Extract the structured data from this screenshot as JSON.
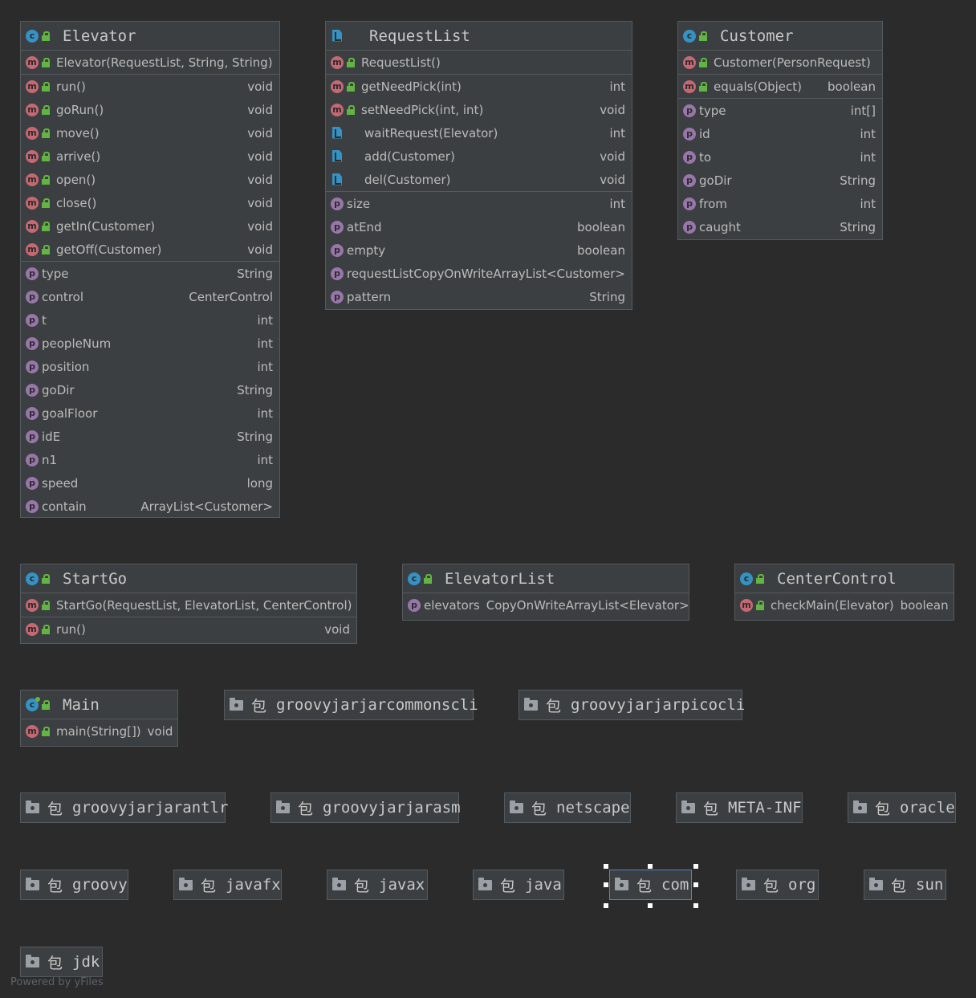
{
  "classes": {
    "elevator": {
      "title": "Elevator",
      "constructor": "Elevator(RequestList, String, String)",
      "methods": [
        {
          "name": "run()",
          "type": "void"
        },
        {
          "name": "goRun()",
          "type": "void"
        },
        {
          "name": "move()",
          "type": "void"
        },
        {
          "name": "arrive()",
          "type": "void"
        },
        {
          "name": "open()",
          "type": "void"
        },
        {
          "name": "close()",
          "type": "void"
        },
        {
          "name": "getIn(Customer)",
          "type": "void"
        },
        {
          "name": "getOff(Customer)",
          "type": "void"
        }
      ],
      "fields": [
        {
          "name": "type",
          "type": "String"
        },
        {
          "name": "control",
          "type": "CenterControl"
        },
        {
          "name": "t",
          "type": "int"
        },
        {
          "name": "peopleNum",
          "type": "int"
        },
        {
          "name": "position",
          "type": "int"
        },
        {
          "name": "goDir",
          "type": "String"
        },
        {
          "name": "goalFloor",
          "type": "int"
        },
        {
          "name": "idE",
          "type": "String"
        },
        {
          "name": "n1",
          "type": "int"
        },
        {
          "name": "speed",
          "type": "long"
        },
        {
          "name": "contain",
          "type": "ArrayList<Customer>"
        }
      ]
    },
    "requestlist": {
      "title": "RequestList",
      "constructor": "RequestList()",
      "methods": [
        {
          "name": "getNeedPick(int)",
          "type": "int"
        },
        {
          "name": "setNeedPick(int, int)",
          "type": "void"
        },
        {
          "name": "waitRequest(Elevator)",
          "type": "int"
        },
        {
          "name": "add(Customer)",
          "type": "void"
        },
        {
          "name": "del(Customer)",
          "type": "void"
        }
      ],
      "fields": [
        {
          "name": "size",
          "type": "int"
        },
        {
          "name": "atEnd",
          "type": "boolean"
        },
        {
          "name": "empty",
          "type": "boolean"
        },
        {
          "name": "requestList",
          "type": "CopyOnWriteArrayList<Customer>"
        },
        {
          "name": "pattern",
          "type": "String"
        }
      ]
    },
    "customer": {
      "title": "Customer",
      "constructor": "Customer(PersonRequest)",
      "methods": [
        {
          "name": "equals(Object)",
          "type": "boolean"
        }
      ],
      "fields": [
        {
          "name": "type",
          "type": "int[]"
        },
        {
          "name": "id",
          "type": "int"
        },
        {
          "name": "to",
          "type": "int"
        },
        {
          "name": "goDir",
          "type": "String"
        },
        {
          "name": "from",
          "type": "int"
        },
        {
          "name": "caught",
          "type": "String"
        }
      ]
    },
    "startgo": {
      "title": "StartGo",
      "constructor": "StartGo(RequestList, ElevatorList, CenterControl)",
      "methods": [
        {
          "name": "run()",
          "type": "void"
        }
      ]
    },
    "elevatorlist": {
      "title": "ElevatorList",
      "fields": [
        {
          "name": "elevators",
          "type": "CopyOnWriteArrayList<Elevator>"
        }
      ]
    },
    "centercontrol": {
      "title": "CenterControl",
      "methods": [
        {
          "name": "checkMain(Elevator)",
          "type": "boolean"
        }
      ]
    },
    "main": {
      "title": "Main",
      "methods": [
        {
          "name": "main(String[])",
          "type": "void"
        }
      ]
    }
  },
  "packages": {
    "prefix": "包",
    "groovyjarjarcommonscli": "groovyjarjarcommonscli",
    "groovyjarjarpicocli": "groovyjarjarpicocli",
    "groovyjarjarantlr": "groovyjarjarantlr",
    "groovyjarjarasm": "groovyjarjarasm",
    "netscape": "netscape",
    "meta_inf": "META-INF",
    "oracle": "oracle",
    "groovy": "groovy",
    "javafx": "javafx",
    "javax": "javax",
    "java": "java",
    "com": "com",
    "org": "org",
    "sun": "sun",
    "jdk": "jdk"
  },
  "footer": "Powered by yFiles",
  "colors": {
    "background": "#2b2b2b",
    "node": "#3c3f41",
    "method_icon": "#c66873",
    "field_icon": "#9876aa",
    "class_icon": "#3592c4",
    "access_lock": "#62b543",
    "selection": "#4a88c7"
  }
}
